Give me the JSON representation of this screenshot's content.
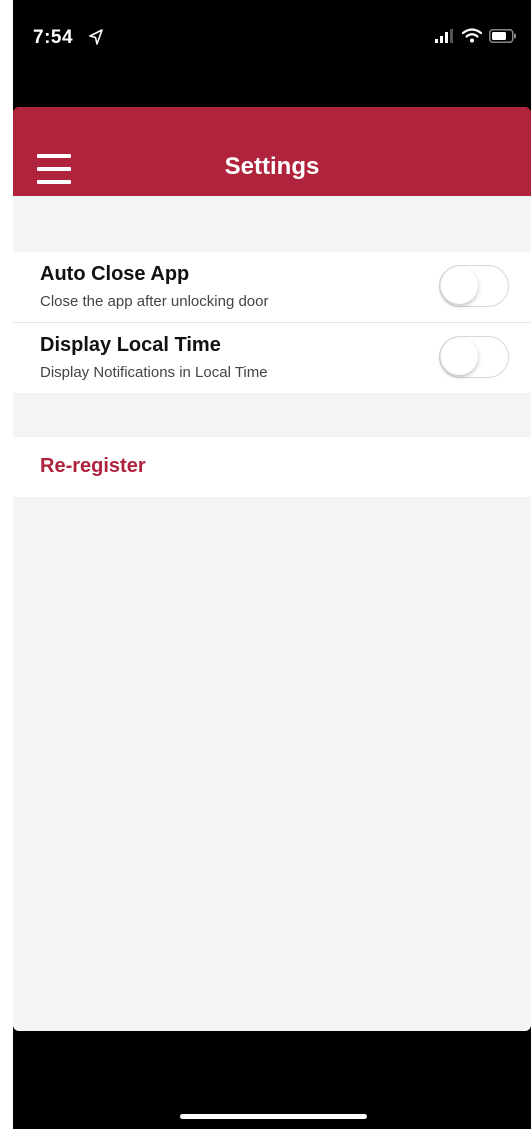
{
  "status_bar": {
    "time": "7:54",
    "icons": [
      "location-arrow-icon",
      "signal-bars-icon",
      "wifi-icon",
      "battery-icon"
    ]
  },
  "header": {
    "title": "Settings",
    "menu_icon": "hamburger-menu-icon",
    "color": "#b0233d"
  },
  "settings": {
    "auto_close": {
      "title": "Auto Close App",
      "subtitle": "Close the app after unlocking door",
      "enabled": false
    },
    "local_time": {
      "title": "Display Local Time",
      "subtitle": "Display Notifications in Local Time",
      "enabled": false
    }
  },
  "actions": {
    "reregister_label": "Re-register"
  },
  "colors": {
    "accent": "#b0233d",
    "background": "#f3f4f4"
  }
}
